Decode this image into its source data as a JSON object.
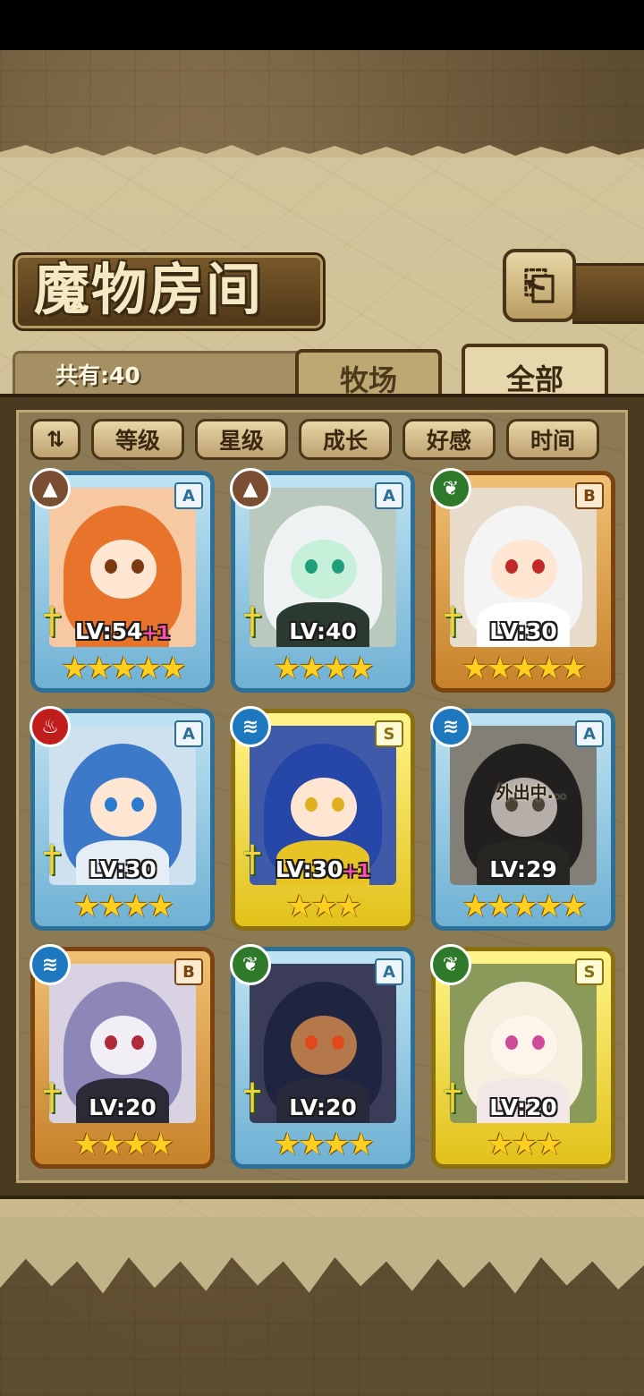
{
  "header": {
    "title": "魔物房间",
    "count_label": "共有:40"
  },
  "tabs": [
    {
      "label": "牧场",
      "active": false
    },
    {
      "label": "全部",
      "active": true
    }
  ],
  "sort_buttons": [
    "等级",
    "星级",
    "成长",
    "好感",
    "时间"
  ],
  "monsters": [
    {
      "element": "earth",
      "rank": "A",
      "level": "LV:54",
      "bonus": "+1",
      "stars": "★★★★★",
      "star_count": 5,
      "frame": "blue"
    },
    {
      "element": "earth",
      "rank": "A",
      "level": "LV:40",
      "bonus": "",
      "stars": "★★★★",
      "star_count": 4,
      "frame": "blue"
    },
    {
      "element": "wood",
      "rank": "B",
      "level": "LV:30",
      "bonus": "",
      "stars": "★★★★★",
      "star_count": 5,
      "frame": "orange"
    },
    {
      "element": "fire",
      "rank": "A",
      "level": "LV:30",
      "bonus": "",
      "stars": "★★★★",
      "star_count": 4,
      "frame": "blue"
    },
    {
      "element": "water",
      "rank": "S",
      "level": "LV:30",
      "bonus": "+1",
      "stars": "★★★",
      "star_count": 3,
      "frame": "yellow"
    },
    {
      "element": "water",
      "rank": "A",
      "level": "LV:29",
      "bonus": "",
      "stars": "★★★★★",
      "star_count": 5,
      "frame": "blue",
      "status": "外出中..."
    },
    {
      "element": "water",
      "rank": "B",
      "level": "LV:20",
      "bonus": "",
      "stars": "★★★★",
      "star_count": 4,
      "frame": "orange"
    },
    {
      "element": "wood",
      "rank": "A",
      "level": "LV:20",
      "bonus": "",
      "stars": "★★★★",
      "star_count": 4,
      "frame": "blue"
    },
    {
      "element": "wood",
      "rank": "S",
      "level": "LV:20",
      "bonus": "",
      "stars": "★★★",
      "star_count": 3,
      "frame": "yellow"
    }
  ],
  "icons": {
    "back": "back-arrow-icon",
    "sort_order": "sort-order-icon",
    "sword": "sword-icon",
    "elements": [
      "earth-element-icon",
      "wood-element-icon",
      "fire-element-icon",
      "water-element-icon"
    ]
  },
  "colors": {
    "parchment": "#cbbb8c",
    "frame_blue": "#2d6f96",
    "frame_orange": "#c7822a",
    "frame_yellow": "#e2c21a",
    "star": "#ffcf1f",
    "bonus": "#ff4fae"
  }
}
